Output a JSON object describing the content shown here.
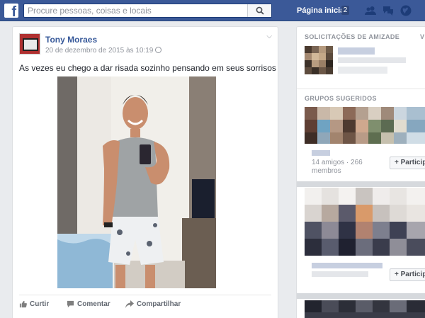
{
  "topbar": {
    "logo": "f",
    "search_placeholder": "Procure pessoas, coisas e locais",
    "home_label": "Página inicial",
    "home_count": "2",
    "icons": [
      "friend-requests-icon",
      "messages-icon",
      "notifications-globe-icon"
    ]
  },
  "post": {
    "author": "Tony Moraes",
    "timestamp": "20 de dezembro de 2015 às 10:19",
    "privacy_icon": "globe-icon",
    "text": "As vezes eu chego a dar risada sozinho pensando em seus sorrisos",
    "actions": {
      "like": "Curtir",
      "comment": "Comentar",
      "share": "Compartilhar"
    }
  },
  "sidebar": {
    "friend_requests_header": "SOLICITAÇÕES DE AMIZADE",
    "friend_requests_extra": "V",
    "groups_header": "GRUPOS SUGERIDOS",
    "group1_stats": "14 amigos · 266 membros",
    "join_label": "+ Particip"
  },
  "colors": {
    "brand": "#3b5998",
    "link": "#365899",
    "background": "#e9ebee"
  }
}
